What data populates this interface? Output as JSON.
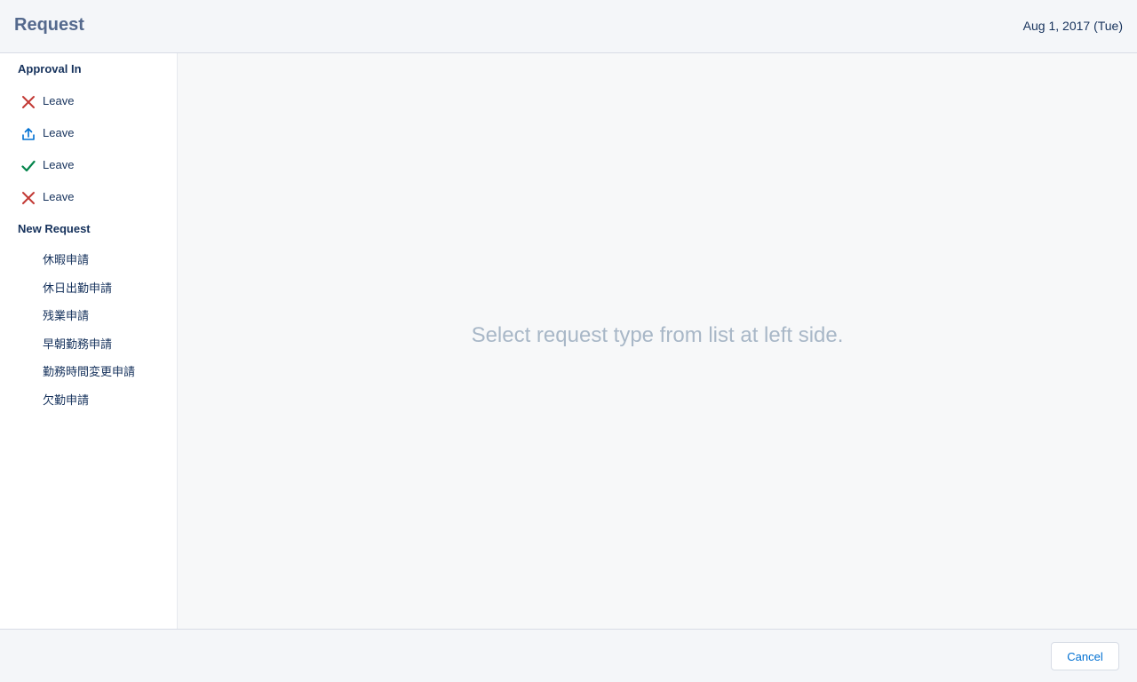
{
  "header": {
    "title": "Request",
    "date": "Aug 1, 2017 (Tue)"
  },
  "sidebar": {
    "approval_title": "Approval In",
    "approval_items": [
      {
        "label": "Leave",
        "icon": "rejected-x-icon",
        "color": "#c23934"
      },
      {
        "label": "Leave",
        "icon": "upload-icon",
        "color": "#0070d2"
      },
      {
        "label": "Leave",
        "icon": "checkmark-icon",
        "color": "#04844b"
      },
      {
        "label": "Leave",
        "icon": "rejected-x-icon",
        "color": "#c23934"
      }
    ],
    "new_request_title": "New Request",
    "new_request_items": [
      {
        "label": "休暇申請"
      },
      {
        "label": "休日出勤申請"
      },
      {
        "label": "残業申請"
      },
      {
        "label": "早朝勤務申請"
      },
      {
        "label": "勤務時間変更申請"
      },
      {
        "label": "欠勤申請"
      }
    ]
  },
  "main": {
    "placeholder": "Select request type from list at left side."
  },
  "footer": {
    "cancel_label": "Cancel"
  }
}
